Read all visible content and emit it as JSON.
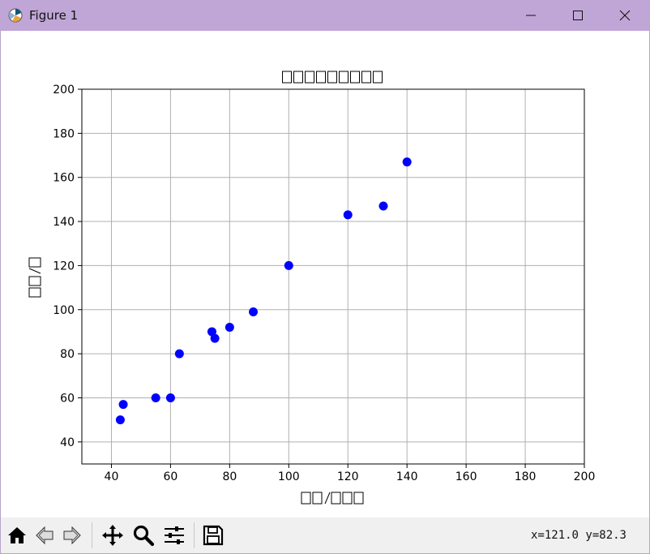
{
  "window": {
    "title": "Figure 1",
    "icons": {
      "app": "matplotlib-figure-icon",
      "minimize": "minimize-icon",
      "maximize": "maximize-icon",
      "close": "close-icon"
    }
  },
  "toolbar": {
    "buttons": [
      {
        "name": "home",
        "icon": "home-icon"
      },
      {
        "name": "back",
        "icon": "back-arrow-icon"
      },
      {
        "name": "forward",
        "icon": "forward-arrow-icon"
      },
      {
        "name": "pan",
        "icon": "move-icon"
      },
      {
        "name": "zoom",
        "icon": "magnifier-icon"
      },
      {
        "name": "configure",
        "icon": "sliders-icon"
      },
      {
        "name": "save",
        "icon": "save-icon"
      }
    ],
    "coords": "x=121.0 y=82.3"
  },
  "chart_data": {
    "type": "scatter",
    "title": "",
    "xlabel": "",
    "ylabel": "",
    "title_glyph_count": 9,
    "xlabel_glyph_count": 5,
    "ylabel_glyph_count": 3,
    "xlabel_slash_after": 2,
    "ylabel_slash_after": 2,
    "xlim": [
      30,
      200
    ],
    "ylim": [
      30,
      200
    ],
    "xticks": [
      40,
      60,
      80,
      100,
      120,
      140,
      160,
      180,
      200
    ],
    "yticks": [
      40,
      60,
      80,
      100,
      120,
      140,
      160,
      180,
      200
    ],
    "grid": true,
    "marker_color": "#0000ff",
    "x": [
      43,
      44,
      55,
      60,
      63,
      74,
      75,
      80,
      88,
      100,
      120,
      132,
      140
    ],
    "y": [
      50,
      57,
      60,
      60,
      80,
      90,
      87,
      92,
      99,
      120,
      143,
      147,
      167
    ]
  }
}
